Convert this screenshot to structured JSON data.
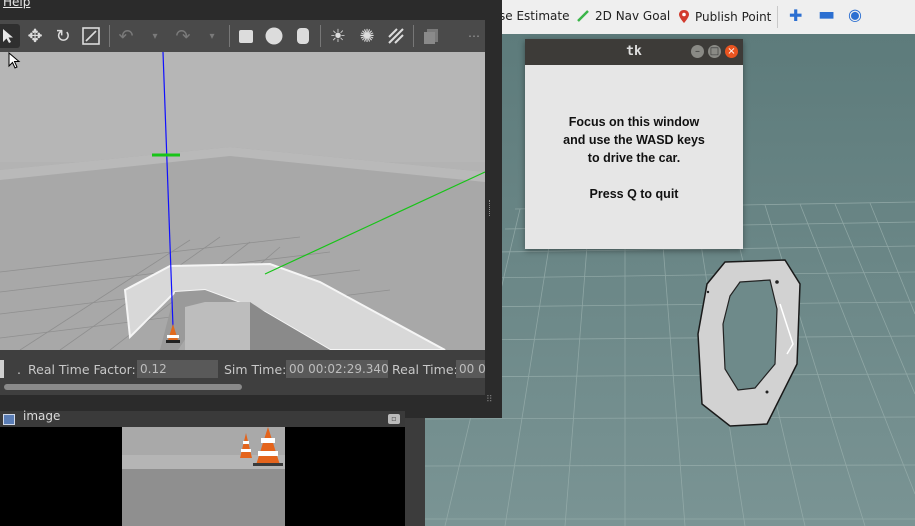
{
  "rviz": {
    "toolbar": {
      "pose_estimate_label": "se Estimate",
      "nav_goal_label": "2D Nav Goal",
      "publish_point_label": "Publish Point"
    },
    "colors": {
      "background": "#6e8a8a",
      "map_free": "#d0d0d0",
      "nav_goal_icon": "#3bb54a",
      "publish_point_icon": "#d23b2e"
    }
  },
  "gazebo": {
    "menu": {
      "help_label": "Help"
    },
    "status": {
      "real_time_factor_label": "Real Time Factor:",
      "real_time_factor_value": "0.12",
      "sim_time_label": "Sim Time:",
      "sim_time_value": "00 00:02:29.340",
      "real_time_label": "Real Time:",
      "real_time_value": "00 0"
    },
    "icons": [
      "select-arrow-icon",
      "translate-icon",
      "rotate-icon",
      "scale-icon",
      "undo-icon",
      "redo-icon",
      "box-icon",
      "sphere-icon",
      "cylinder-icon",
      "point-light-icon",
      "spot-light-icon",
      "directional-light-icon",
      "copy-icon"
    ]
  },
  "image_window": {
    "title": "image"
  },
  "tk_window": {
    "title": "tk",
    "lines": [
      "Focus on this window",
      "and use the WASD keys",
      "to drive the car.",
      "",
      "Press Q to quit"
    ]
  }
}
